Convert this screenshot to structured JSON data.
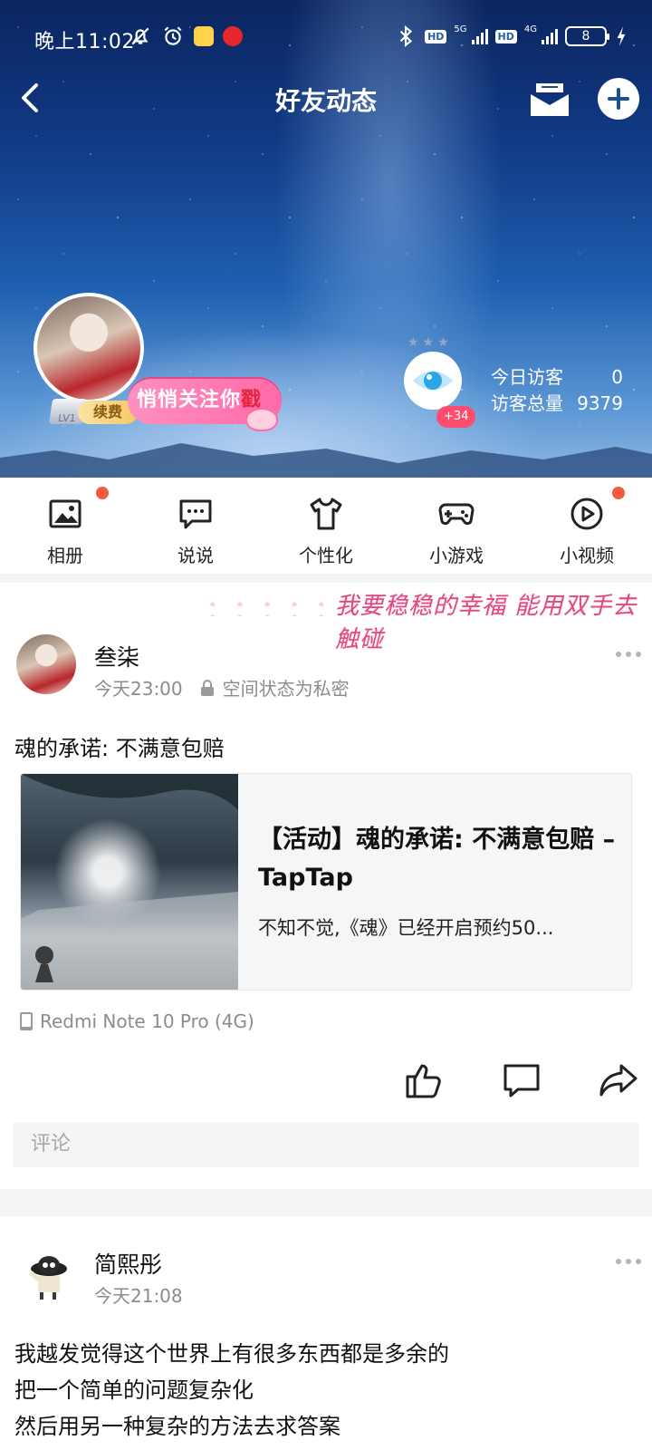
{
  "status_bar": {
    "time": "晚上11:02",
    "network_hd": "HD",
    "network_5g": "5G",
    "network_4g": "4G",
    "battery": "8"
  },
  "nav": {
    "title": "好友动态"
  },
  "profile": {
    "level": "LV1",
    "renew_label": "续费",
    "follow_bubble": "悄悄关注你",
    "follow_bubble_accent": "戳",
    "eye_count": "+34",
    "today_visitors_label": "今日访客",
    "today_visitors_value": "0",
    "total_visitors_label": "访客总量",
    "total_visitors_value": "9379"
  },
  "quick_menu": [
    {
      "label": "相册",
      "icon": "photo-album-icon",
      "dot": true
    },
    {
      "label": "说说",
      "icon": "chat-bubble-icon",
      "dot": false
    },
    {
      "label": "个性化",
      "icon": "tshirt-icon",
      "dot": true
    },
    {
      "label": "小游戏",
      "icon": "gamepad-icon",
      "dot": false
    },
    {
      "label": "小视频",
      "icon": "play-circle-icon",
      "dot": false
    }
  ],
  "post1": {
    "banner": "我要稳稳的幸福 能用双手去触碰",
    "author": "叁柒",
    "time": "今天23:00",
    "privacy": "空间状态为私密",
    "text": "魂的承诺: 不满意包赔",
    "link_title": "【活动】魂的承诺: 不满意包赔 – TapTap",
    "link_desc": "不知不觉,《魂》已经开启预约50...",
    "device": "Redmi Note 10 Pro (4G)",
    "comment_placeholder": "评论"
  },
  "post2": {
    "author": "简熙彤",
    "time": "今天21:08",
    "lines": [
      "我越发觉得这个世界上有很多东西都是多余的",
      "把一个简单的问题复杂化",
      "然后用另一种复杂的方法去求答案"
    ]
  },
  "colors": {
    "accent_red_dot": "#f25a3c",
    "pink_badge": "#ff4d6d",
    "renew_gold": "#f4c866"
  }
}
